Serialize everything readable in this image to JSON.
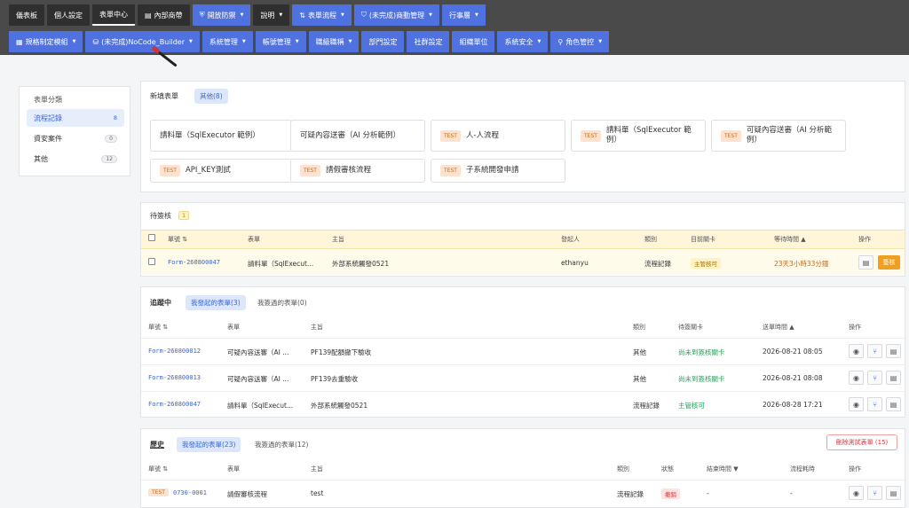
{
  "nav_row1": [
    {
      "label": "儀表板",
      "style": "dark",
      "caret": false,
      "icon": ""
    },
    {
      "label": "個人設定",
      "style": "dark",
      "caret": false,
      "icon": ""
    },
    {
      "label": "表單中心",
      "style": "dark",
      "caret": false,
      "icon": "",
      "active": true
    },
    {
      "label": "內部商帶",
      "style": "dark",
      "caret": false,
      "icon": "▤"
    },
    {
      "label": "開放防禦",
      "style": "blue",
      "caret": true,
      "icon": "⛨"
    },
    {
      "label": "說明",
      "style": "dark",
      "caret": true,
      "icon": ""
    },
    {
      "label": "表單流程",
      "style": "blue",
      "caret": true,
      "icon": "⇅"
    },
    {
      "label": "(未完成)商動管理",
      "style": "blue",
      "caret": true,
      "icon": "⛉"
    },
    {
      "label": "行事層",
      "style": "blue",
      "caret": true,
      "icon": ""
    }
  ],
  "nav_row2": [
    {
      "label": "規格制定模組",
      "caret": true,
      "icon": "▦"
    },
    {
      "label": "(未完成)NoCode_Builder",
      "caret": true,
      "icon": "⛁"
    },
    {
      "label": "系統管理",
      "caret": true,
      "icon": ""
    },
    {
      "label": "帳號管理",
      "caret": true,
      "icon": ""
    },
    {
      "label": "職級職稱",
      "caret": true,
      "icon": ""
    },
    {
      "label": "部門設定",
      "caret": false,
      "icon": ""
    },
    {
      "label": "社群設定",
      "caret": false,
      "icon": ""
    },
    {
      "label": "組織單位",
      "caret": false,
      "icon": ""
    },
    {
      "label": "系統安全",
      "caret": true,
      "icon": ""
    },
    {
      "label": "角色管控",
      "caret": true,
      "icon": "⚲"
    }
  ],
  "sidebar": {
    "title": "表單分類",
    "items": [
      {
        "label": "流程記錄",
        "count": "8",
        "active": true
      },
      {
        "label": "資安案件",
        "count": "0"
      },
      {
        "label": "其他",
        "count": "12"
      }
    ]
  },
  "new_form": {
    "title": "新填表單",
    "tab": "其他(8)",
    "tag": "TEST",
    "forms": [
      {
        "label": "請料單（SqlExecutor 範例）",
        "test": false
      },
      {
        "label": "可疑內容送審（AI 分析範例）",
        "test": false
      },
      {
        "label": "人-人流程",
        "test": true
      },
      {
        "label": "請料單（SqlExecutor 範例）",
        "test": true
      },
      {
        "label": "可疑內容送審（AI 分析範例）",
        "test": true
      },
      {
        "label": "API_KEY測試",
        "test": true
      },
      {
        "label": "請假審核流程",
        "test": true
      },
      {
        "label": "子系統開發申請",
        "test": true
      }
    ]
  },
  "pending": {
    "title": "待簽核",
    "count": "1",
    "headers": [
      "單號 ⇅",
      "表單",
      "主旨",
      "發起人",
      "類別",
      "目前關卡",
      "等待時間 ▲",
      "操作"
    ],
    "row": {
      "id": "Form-260800047",
      "form": "請料單（SqlExecut...",
      "subject": "外部系統觸發0521",
      "initiator": "ethanyu",
      "category": "流程記錄",
      "stage": "主管核可",
      "wait": "23天3小時33分鐘",
      "sign": "簽核"
    }
  },
  "tracking": {
    "title": "追蹤中",
    "tab_on": "我發起的表單(3)",
    "tab_off": "我簽過的表單(0)",
    "headers": [
      "單號 ⇅",
      "表單",
      "主旨",
      "類別",
      "待簽關卡",
      "送單時間 ▲",
      "操作"
    ],
    "rows": [
      {
        "id": "Form-260800012",
        "form": "可疑內容送審（AI ...",
        "subject": "PF139配額撤下驗收",
        "category": "其他",
        "stage": "尚未到簽核關卡",
        "time": "2026-08-21 08:05"
      },
      {
        "id": "Form-260800013",
        "form": "可疑內容送審（AI ...",
        "subject": "PF139去重驗收",
        "category": "其他",
        "stage": "尚未到簽核關卡",
        "time": "2026-08-21 08:08"
      },
      {
        "id": "Form-260800047",
        "form": "請料單（SqlExecut...",
        "subject": "外部系統觸發0521",
        "category": "流程記錄",
        "stage": "主管核可",
        "time": "2026-08-28 17:21"
      }
    ]
  },
  "history": {
    "title": "歷史",
    "tab_on": "我發起的表單(23)",
    "tab_off": "我簽過的表單(12)",
    "delete_btn": "刪除測試表單 (15)",
    "headers": [
      "單號 ⇅",
      "表單",
      "主旨",
      "類別",
      "狀態",
      "結束時間 ▼",
      "流程耗時",
      "操作"
    ],
    "rows": [
      {
        "tag": "TEST",
        "id": "0730-0001",
        "form": "請假審核流程",
        "subject": "test",
        "category": "流程記錄",
        "status": "撤銷",
        "end": "-",
        "duration": "-"
      }
    ]
  },
  "icons": {
    "view": "eye-icon",
    "branch": "branch-icon",
    "doc": "document-icon"
  },
  "colors": {
    "nav_bg": "#4a4a4a",
    "nav_blue": "#4f72e0",
    "accent": "#3a66d6",
    "sign": "#f0a020"
  }
}
